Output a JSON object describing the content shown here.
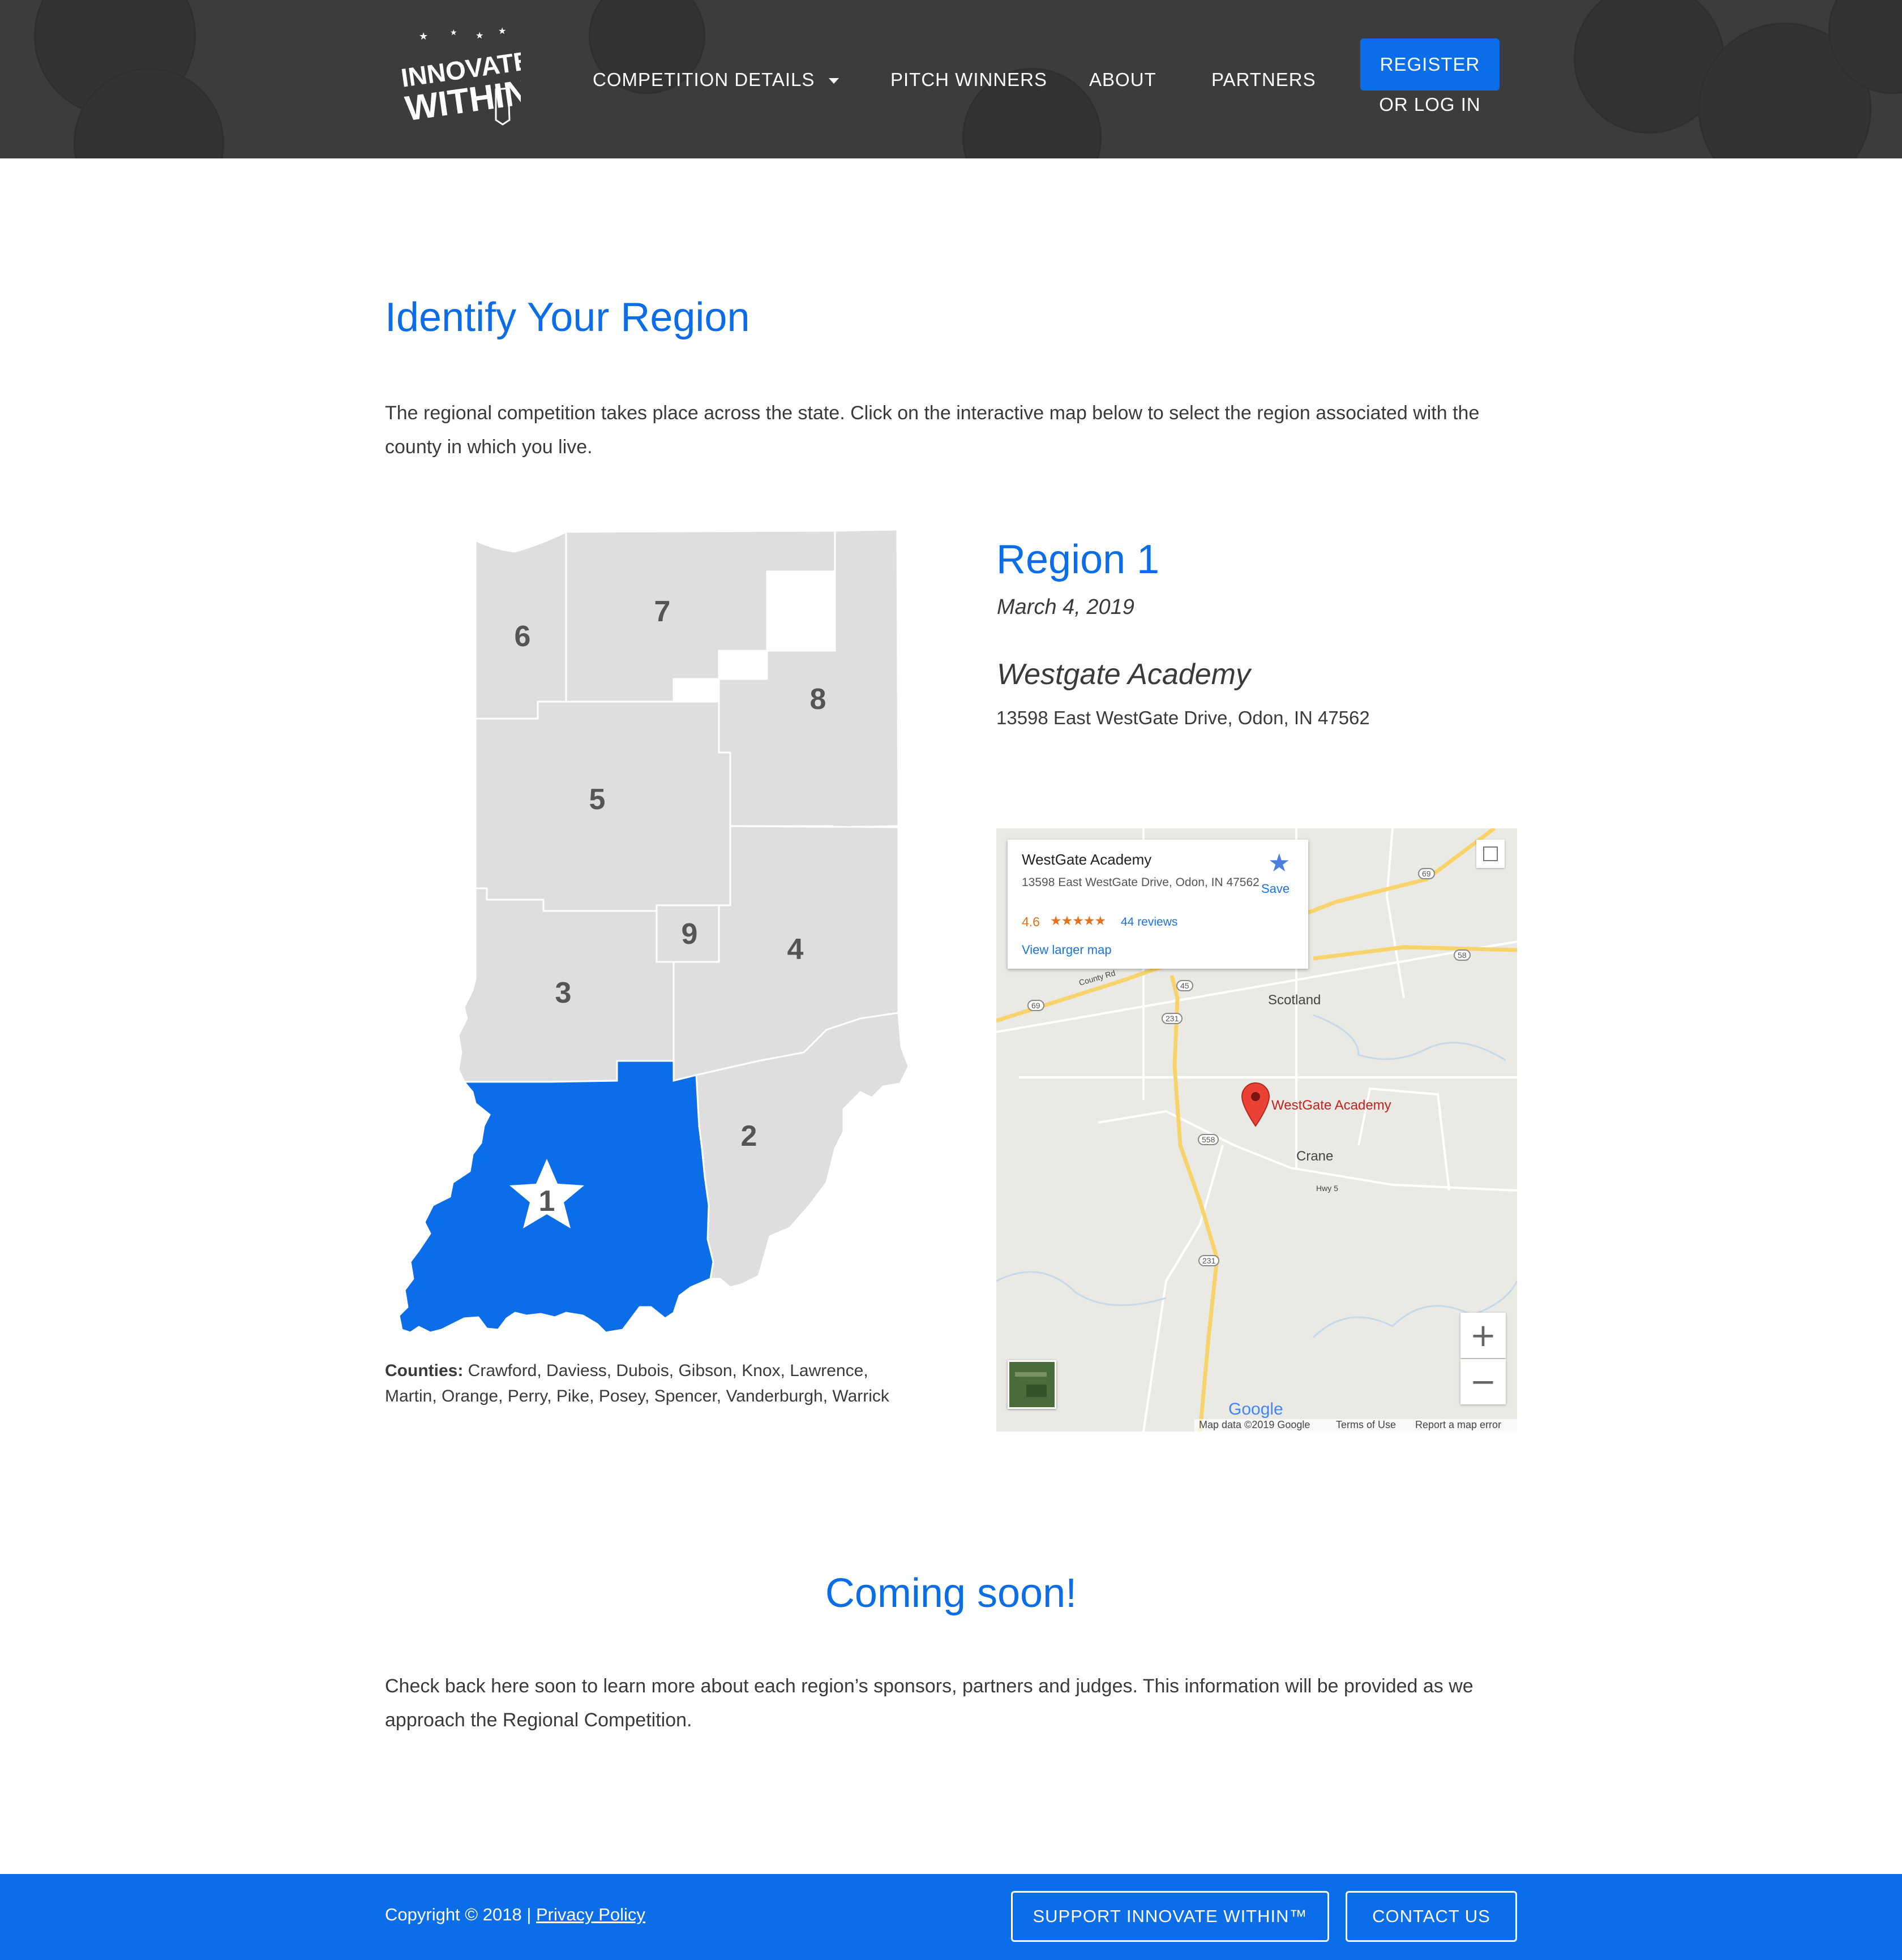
{
  "header": {
    "logo_text_line1": "INNOVATE",
    "logo_text_line2": "WITHIN",
    "nav": {
      "competition_details": "COMPETITION DETAILS",
      "pitch_winners": "PITCH WINNERS",
      "about": "ABOUT",
      "partners": "PARTNERS"
    },
    "register_label": "REGISTER",
    "login_label": "OR LOG IN"
  },
  "intro": {
    "title": "Identify Your Region",
    "text": "The regional competition takes place across the state. Click on the interactive map below to select the region associated with the county in which you live."
  },
  "region_map": {
    "labels": [
      "1",
      "2",
      "3",
      "4",
      "5",
      "6",
      "7",
      "8",
      "9"
    ],
    "selected_region": "1",
    "selected_color": "#0b6de8",
    "region_color": "#dededf"
  },
  "counties": {
    "label": "Counties:",
    "list": "Crawford, Daviess, Dubois, Gibson, Knox, Lawrence, Martin, Orange, Perry, Pike, Posey, Spencer, Vanderburgh, Warrick"
  },
  "region": {
    "title": "Region 1",
    "date": "March 4, 2019",
    "venue": "Westgate Academy",
    "address": "13598 East WestGate Drive, Odon, IN 47562"
  },
  "map_embed": {
    "place_name": "WestGate Academy",
    "place_address": "13598 East WestGate Drive, Odon, IN 47562",
    "rating": "4.6",
    "stars": "★★★★★",
    "reviews": "44 reviews",
    "larger_map": "View larger map",
    "save": "Save",
    "marker_label": "WestGate Academy",
    "towns": {
      "scotland": "Scotland",
      "crane": "Crane"
    },
    "road_labels": {
      "hwy5": "Hwy 5",
      "county_rd": "County Rd"
    },
    "shields": {
      "i69a": "69",
      "i69b": "69",
      "r58": "58",
      "r45": "45",
      "r231a": "231",
      "r558": "558",
      "r231b": "231"
    },
    "google_logo": "Google",
    "map_data": "Map data ©2019 Google",
    "terms": "Terms of Use",
    "report": "Report a map error",
    "zoom_in": "+",
    "zoom_out": "−"
  },
  "coming_soon": {
    "title": "Coming soon!",
    "text": "Check back here soon to learn more about each region’s sponsors, partners and judges. This information will be provided as we approach the Regional Competition."
  },
  "footer": {
    "copyright": "Copyright © 2018 |",
    "privacy": "Privacy Policy",
    "support_label": "SUPPORT INNOVATE WITHIN™",
    "contact_label": "CONTACT US"
  }
}
